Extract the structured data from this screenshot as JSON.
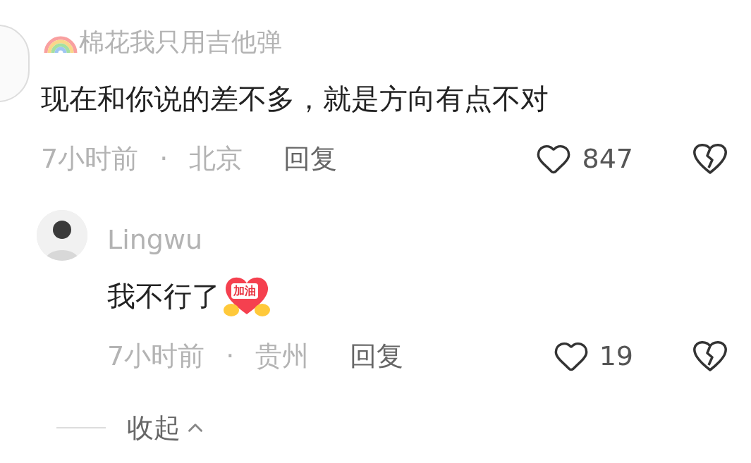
{
  "comment": {
    "username": "棉花我只用吉他弹",
    "text": "现在和你说的差不多，就是方向有点不对",
    "time": "7小时前",
    "separator": "·",
    "location": "北京",
    "reply_action": "回复",
    "likes": "847",
    "replies": [
      {
        "username": "Lingwu",
        "text": "我不行了",
        "sticker": "加油",
        "time": "7小时前",
        "separator": "·",
        "location": "贵州",
        "reply_action": "回复",
        "likes": "19"
      }
    ]
  },
  "collapse": {
    "label": "收起"
  }
}
